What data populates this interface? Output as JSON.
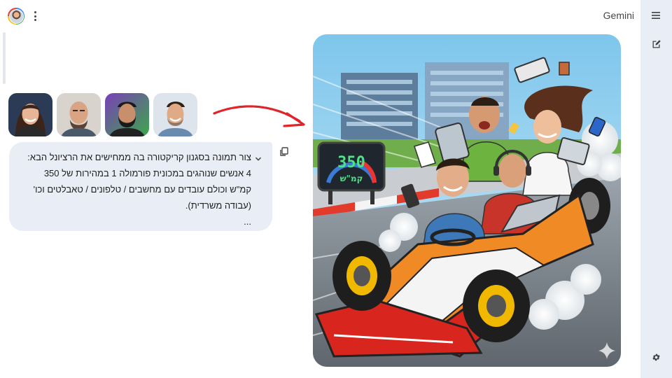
{
  "app": {
    "brand": "Gemini"
  },
  "prompt": {
    "lines": [
      "צור תמונה בסגנון קריקטורה בה ממחישים את הרציונל הבא:",
      "4 אנשים שנוהגים במכונית פורמולה 1 במהירות של 350",
      "קמ\"ש וכולם עובדים עם מחשבים / טלפונים / טאבלטים וכו'",
      "(עבודה משרדית).",
      "..."
    ]
  },
  "uploaded_photos": [
    {
      "name": "woman-photo"
    },
    {
      "name": "bald-man-photo"
    },
    {
      "name": "bearded-man-photo"
    },
    {
      "name": "smiling-man-photo"
    }
  ],
  "generated_image": {
    "speedometer_value": "350",
    "speedometer_unit": "קמ\"ש"
  },
  "icons": {
    "menu": "menu-icon",
    "edit": "edit-note-icon",
    "settings": "gear-icon",
    "more": "more-vert-icon",
    "copy": "copy-icon",
    "expand": "chevron-down-icon",
    "sparkle": "sparkle-icon"
  },
  "colors": {
    "rail_bg": "#e9eef6",
    "bubble_bg": "#e9eef6",
    "arrow_red": "#e0252a",
    "car_red": "#d8261f",
    "car_orange": "#f08a24"
  }
}
